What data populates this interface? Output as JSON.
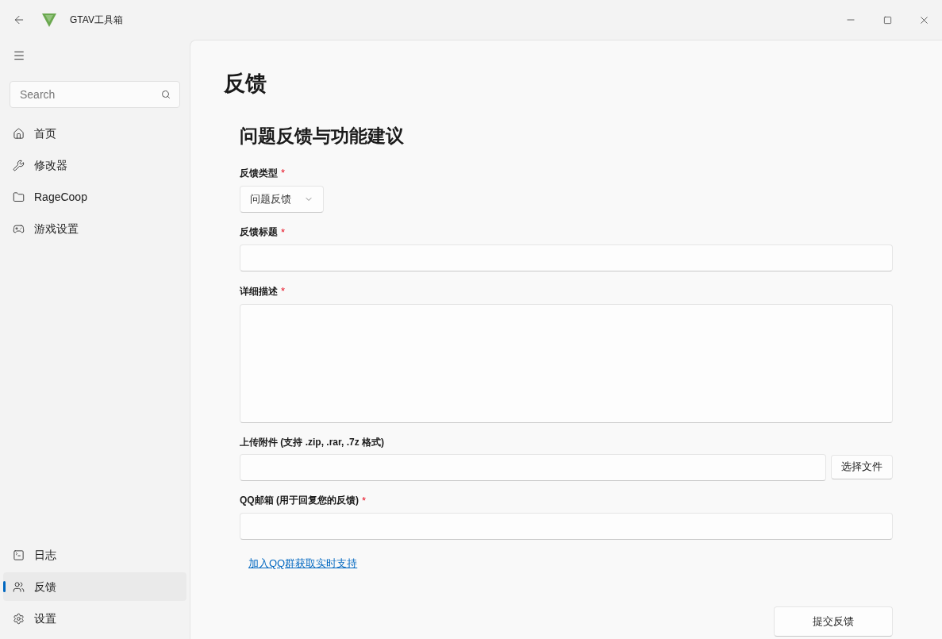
{
  "window": {
    "title": "GTAV工具箱"
  },
  "sidebar": {
    "search": {
      "placeholder": "Search"
    },
    "items": [
      {
        "label": "首页",
        "selected": false
      },
      {
        "label": "修改器",
        "selected": false
      },
      {
        "label": "RageCoop",
        "selected": false
      },
      {
        "label": "游戏设置",
        "selected": false
      }
    ],
    "footer_items": [
      {
        "label": "日志",
        "selected": false
      },
      {
        "label": "反馈",
        "selected": true
      },
      {
        "label": "设置",
        "selected": false
      }
    ]
  },
  "page": {
    "title": "反馈",
    "heading": "问题反馈与功能建议",
    "required_mark": "*",
    "fields": [
      {
        "kind": "select",
        "label": "反馈类型",
        "required": true,
        "value": "问题反馈"
      },
      {
        "kind": "text",
        "label": "反馈标题",
        "required": true
      },
      {
        "kind": "textarea",
        "label": "详细描述",
        "required": true
      },
      {
        "kind": "file",
        "label": "上传附件 (支持 .zip, .rar, .7z 格式)",
        "required": false,
        "button": "选择文件"
      },
      {
        "kind": "text",
        "label": "QQ邮箱 (用于回复您的反馈)",
        "required": true
      }
    ],
    "link": "加入QQ群获取实时支持",
    "submit": "提交反馈"
  }
}
